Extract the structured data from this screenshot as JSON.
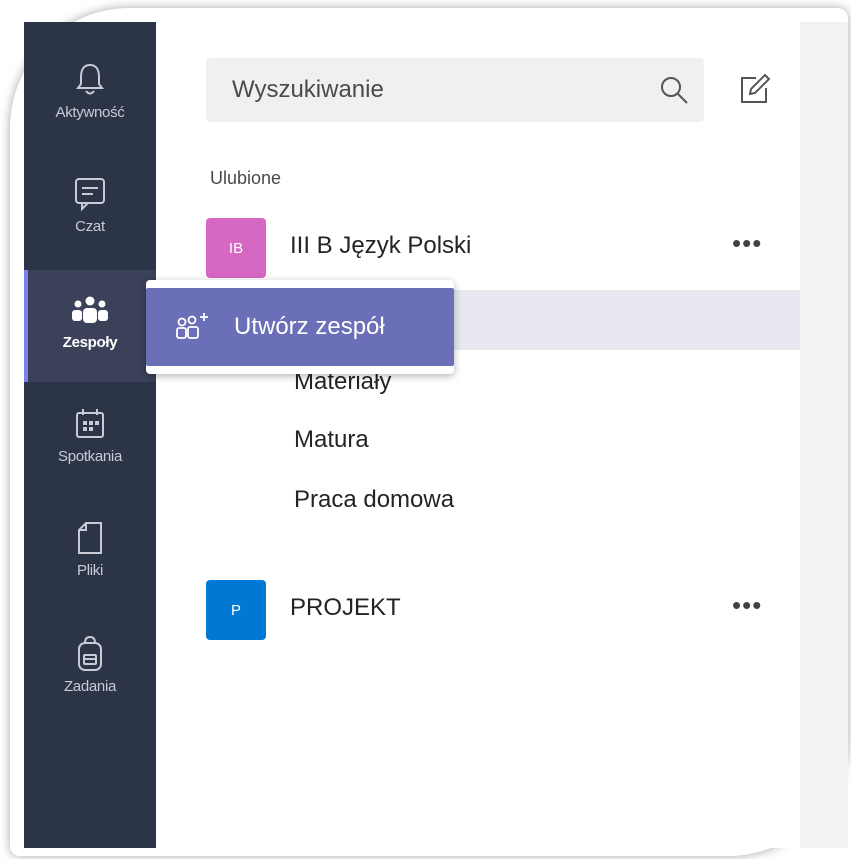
{
  "rail": {
    "items": [
      {
        "label": "Aktywność",
        "icon": "bell-icon"
      },
      {
        "label": "Czat",
        "icon": "chat-icon"
      },
      {
        "label": "Zespoły",
        "icon": "teams-icon",
        "active": true
      },
      {
        "label": "Spotkania",
        "icon": "calendar-icon"
      },
      {
        "label": "Pliki",
        "icon": "file-icon"
      },
      {
        "label": "Zadania",
        "icon": "backpack-icon"
      }
    ]
  },
  "search": {
    "placeholder": "Wyszukiwanie"
  },
  "sections": {
    "favorites_label": "Ulubione"
  },
  "teams": [
    {
      "initials": "IB",
      "name": "III B Język Polski",
      "more": "•••",
      "color": "#d667c3"
    },
    {
      "initials": "P",
      "name": "PROJEKT",
      "more": "•••",
      "color": "#0078d4"
    }
  ],
  "channels": [
    "Materiały",
    "Matura",
    "Praca domowa"
  ],
  "popup": {
    "create_team_label": "Utwórz zespół"
  },
  "colors": {
    "rail": "#2c3447",
    "accent": "#6b6fb8"
  }
}
